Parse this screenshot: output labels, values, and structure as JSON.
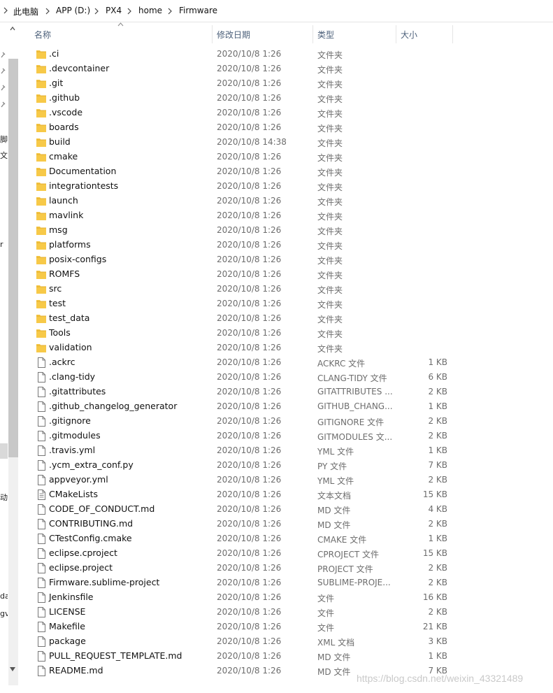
{
  "breadcrumb": [
    "此电脑",
    "APP (D:)",
    "PX4",
    "home",
    "Firmware"
  ],
  "columns": {
    "name": "名称",
    "date": "修改日期",
    "type": "类型",
    "size": "大小"
  },
  "nav_fragments": [
    "脚本",
    "文件",
    "r",
    "动",
    "da",
    "gv"
  ],
  "files": [
    {
      "name": ".ci",
      "date": "2020/10/8 1:26",
      "type": "文件夹",
      "size": "",
      "kind": "folder"
    },
    {
      "name": ".devcontainer",
      "date": "2020/10/8 1:26",
      "type": "文件夹",
      "size": "",
      "kind": "folder"
    },
    {
      "name": ".git",
      "date": "2020/10/8 1:26",
      "type": "文件夹",
      "size": "",
      "kind": "folder"
    },
    {
      "name": ".github",
      "date": "2020/10/8 1:26",
      "type": "文件夹",
      "size": "",
      "kind": "folder"
    },
    {
      "name": ".vscode",
      "date": "2020/10/8 1:26",
      "type": "文件夹",
      "size": "",
      "kind": "folder"
    },
    {
      "name": "boards",
      "date": "2020/10/8 1:26",
      "type": "文件夹",
      "size": "",
      "kind": "folder"
    },
    {
      "name": "build",
      "date": "2020/10/8 14:38",
      "type": "文件夹",
      "size": "",
      "kind": "folder"
    },
    {
      "name": "cmake",
      "date": "2020/10/8 1:26",
      "type": "文件夹",
      "size": "",
      "kind": "folder"
    },
    {
      "name": "Documentation",
      "date": "2020/10/8 1:26",
      "type": "文件夹",
      "size": "",
      "kind": "folder"
    },
    {
      "name": "integrationtests",
      "date": "2020/10/8 1:26",
      "type": "文件夹",
      "size": "",
      "kind": "folder"
    },
    {
      "name": "launch",
      "date": "2020/10/8 1:26",
      "type": "文件夹",
      "size": "",
      "kind": "folder"
    },
    {
      "name": "mavlink",
      "date": "2020/10/8 1:26",
      "type": "文件夹",
      "size": "",
      "kind": "folder"
    },
    {
      "name": "msg",
      "date": "2020/10/8 1:26",
      "type": "文件夹",
      "size": "",
      "kind": "folder"
    },
    {
      "name": "platforms",
      "date": "2020/10/8 1:26",
      "type": "文件夹",
      "size": "",
      "kind": "folder"
    },
    {
      "name": "posix-configs",
      "date": "2020/10/8 1:26",
      "type": "文件夹",
      "size": "",
      "kind": "folder"
    },
    {
      "name": "ROMFS",
      "date": "2020/10/8 1:26",
      "type": "文件夹",
      "size": "",
      "kind": "folder"
    },
    {
      "name": "src",
      "date": "2020/10/8 1:26",
      "type": "文件夹",
      "size": "",
      "kind": "folder"
    },
    {
      "name": "test",
      "date": "2020/10/8 1:26",
      "type": "文件夹",
      "size": "",
      "kind": "folder"
    },
    {
      "name": "test_data",
      "date": "2020/10/8 1:26",
      "type": "文件夹",
      "size": "",
      "kind": "folder"
    },
    {
      "name": "Tools",
      "date": "2020/10/8 1:26",
      "type": "文件夹",
      "size": "",
      "kind": "folder"
    },
    {
      "name": "validation",
      "date": "2020/10/8 1:26",
      "type": "文件夹",
      "size": "",
      "kind": "folder"
    },
    {
      "name": ".ackrc",
      "date": "2020/10/8 1:26",
      "type": "ACKRC 文件",
      "size": "1 KB",
      "kind": "file"
    },
    {
      "name": ".clang-tidy",
      "date": "2020/10/8 1:26",
      "type": "CLANG-TIDY 文件",
      "size": "6 KB",
      "kind": "file"
    },
    {
      "name": ".gitattributes",
      "date": "2020/10/8 1:26",
      "type": "GITATTRIBUTES ...",
      "size": "2 KB",
      "kind": "file"
    },
    {
      "name": ".github_changelog_generator",
      "date": "2020/10/8 1:26",
      "type": "GITHUB_CHANG...",
      "size": "1 KB",
      "kind": "file"
    },
    {
      "name": ".gitignore",
      "date": "2020/10/8 1:26",
      "type": "GITIGNORE 文件",
      "size": "2 KB",
      "kind": "file"
    },
    {
      "name": ".gitmodules",
      "date": "2020/10/8 1:26",
      "type": "GITMODULES 文...",
      "size": "2 KB",
      "kind": "file"
    },
    {
      "name": ".travis.yml",
      "date": "2020/10/8 1:26",
      "type": "YML 文件",
      "size": "1 KB",
      "kind": "file"
    },
    {
      "name": ".ycm_extra_conf.py",
      "date": "2020/10/8 1:26",
      "type": "PY 文件",
      "size": "7 KB",
      "kind": "file"
    },
    {
      "name": "appveyor.yml",
      "date": "2020/10/8 1:26",
      "type": "YML 文件",
      "size": "2 KB",
      "kind": "file"
    },
    {
      "name": "CMakeLists",
      "date": "2020/10/8 1:26",
      "type": "文本文档",
      "size": "15 KB",
      "kind": "text"
    },
    {
      "name": "CODE_OF_CONDUCT.md",
      "date": "2020/10/8 1:26",
      "type": "MD 文件",
      "size": "4 KB",
      "kind": "file"
    },
    {
      "name": "CONTRIBUTING.md",
      "date": "2020/10/8 1:26",
      "type": "MD 文件",
      "size": "2 KB",
      "kind": "file"
    },
    {
      "name": "CTestConfig.cmake",
      "date": "2020/10/8 1:26",
      "type": "CMAKE 文件",
      "size": "1 KB",
      "kind": "file"
    },
    {
      "name": "eclipse.cproject",
      "date": "2020/10/8 1:26",
      "type": "CPROJECT 文件",
      "size": "15 KB",
      "kind": "file"
    },
    {
      "name": "eclipse.project",
      "date": "2020/10/8 1:26",
      "type": "PROJECT 文件",
      "size": "2 KB",
      "kind": "file"
    },
    {
      "name": "Firmware.sublime-project",
      "date": "2020/10/8 1:26",
      "type": "SUBLIME-PROJE...",
      "size": "2 KB",
      "kind": "file"
    },
    {
      "name": "Jenkinsfile",
      "date": "2020/10/8 1:26",
      "type": "文件",
      "size": "16 KB",
      "kind": "file"
    },
    {
      "name": "LICENSE",
      "date": "2020/10/8 1:26",
      "type": "文件",
      "size": "2 KB",
      "kind": "file"
    },
    {
      "name": "Makefile",
      "date": "2020/10/8 1:26",
      "type": "文件",
      "size": "21 KB",
      "kind": "file"
    },
    {
      "name": "package",
      "date": "2020/10/8 1:26",
      "type": "XML 文档",
      "size": "3 KB",
      "kind": "file"
    },
    {
      "name": "PULL_REQUEST_TEMPLATE.md",
      "date": "2020/10/8 1:26",
      "type": "MD 文件",
      "size": "1 KB",
      "kind": "file"
    },
    {
      "name": "README.md",
      "date": "2020/10/8 1:26",
      "type": "MD 文件",
      "size": "7 KB",
      "kind": "file"
    }
  ],
  "watermark": "https://blog.csdn.net/weixin_43321489",
  "colors": {
    "folder": "#f7c948",
    "folder_dark": "#e3ad2c",
    "header_text": "#4c607a"
  }
}
